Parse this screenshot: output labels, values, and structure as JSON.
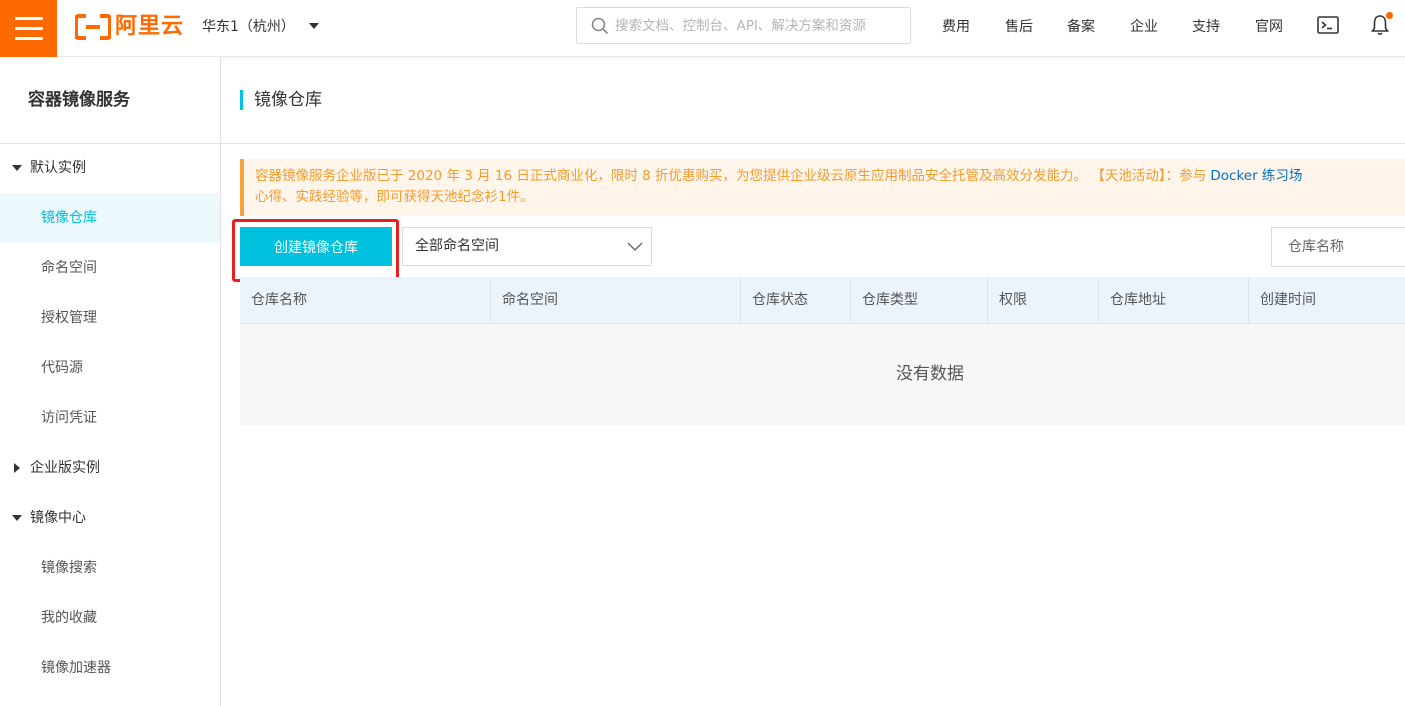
{
  "header": {
    "logo_text": "阿里云",
    "region": "华东1（杭州）",
    "search_placeholder": "搜索文档、控制台、API、解决方案和资源",
    "nav": [
      "费用",
      "售后",
      "备案",
      "企业",
      "支持",
      "官网"
    ],
    "accent_color": "#ff6a00"
  },
  "sidebar": {
    "title": "容器镜像服务",
    "groups": [
      {
        "label": "默认实例",
        "expanded": true,
        "items": [
          "镜像仓库",
          "命名空间",
          "授权管理",
          "代码源",
          "访问凭证"
        ]
      },
      {
        "label": "企业版实例",
        "expanded": false,
        "items": []
      },
      {
        "label": "镜像中心",
        "expanded": true,
        "items": [
          "镜像搜索",
          "我的收藏",
          "镜像加速器"
        ]
      }
    ],
    "active_item": "镜像仓库"
  },
  "main": {
    "page_title": "镜像仓库",
    "notice": {
      "line1_text": "容器镜像服务企业版已于 2020 年 3 月 16 日正式商业化，限时 8 折优惠购买，为您提供企业级云原生应用制品安全托管及高效分发能力。 【天池活动】：参与 ",
      "line1_link": "Docker 练习场",
      "line2_text": "心得、实践经验等，即可获得天池纪念衫1件。"
    },
    "create_button": "创建镜像仓库",
    "namespace_select": "全部命名空间",
    "repo_search_placeholder": "仓库名称",
    "table": {
      "columns": [
        "仓库名称",
        "命名空间",
        "仓库状态",
        "仓库类型",
        "权限",
        "仓库地址",
        "创建时间"
      ],
      "rows": [],
      "empty_text": "没有数据"
    },
    "theme_color": "#00c1de"
  }
}
